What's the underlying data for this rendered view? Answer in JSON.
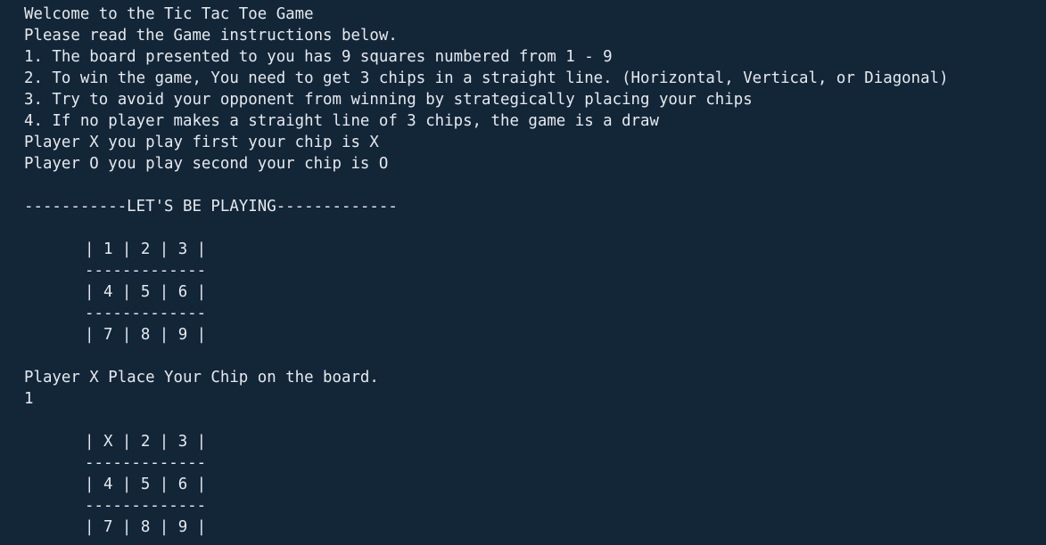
{
  "terminal": {
    "instructions": [
      "Welcome to the Tic Tac Toe Game",
      "Please read the Game instructions below.",
      "1. The board presented to you has 9 squares numbered from 1 - 9",
      "2. To win the game, You need to get 3 chips in a straight line. (Horizontal, Vertical, or Diagonal)",
      "3. Try to avoid your opponent from winning by strategically placing your chips",
      "4. If no player makes a straight line of 3 chips, the game is a draw",
      "Player X you play first your chip is X",
      "Player O you play second your chip is O"
    ],
    "banner": "-----------LET'S BE PLAYING-------------",
    "board1": {
      "rows": [
        "| 1 | 2 | 3 |",
        "| 4 | 5 | 6 |",
        "| 7 | 8 | 9 |"
      ],
      "separator": "-------------"
    },
    "prompt": "Player X Place Your Chip on the board.",
    "user_input": "1",
    "board2": {
      "rows": [
        "| X | 2 | 3 |",
        "| 4 | 5 | 6 |",
        "| 7 | 8 | 9 |"
      ],
      "separator": "-------------"
    }
  }
}
